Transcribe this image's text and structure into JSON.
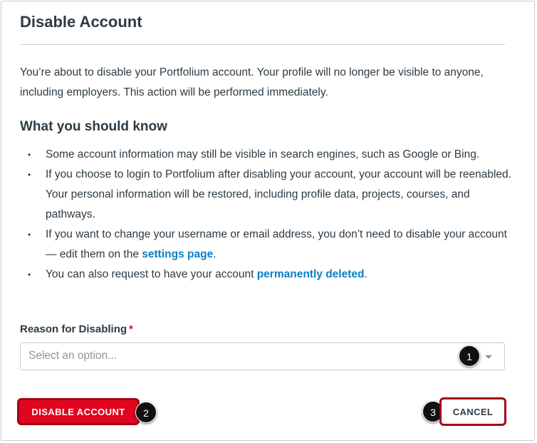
{
  "dialog": {
    "title": "Disable Account",
    "intro": "You’re about to disable your Portfolium account. Your profile will no longer be visible to anyone, including employers. This action will be performed immediately.",
    "subtitle": "What you should know",
    "bullets": {
      "b1": "Some account information may still be visible in search engines, such as Google or Bing.",
      "b2": "If you choose to login to Portfolium after disabling your account, your account will be reenabled. Your personal information will be restored, including profile data, projects, courses, and pathways.",
      "b3_before": "If you want to change your username or email address, you don’t need to disable your account — edit them on the ",
      "b3_link": "settings page",
      "b3_after": ".",
      "b4_before": "You can also request to have your account ",
      "b4_link": "permanently deleted",
      "b4_after": "."
    },
    "reason": {
      "label": "Reason for Disabling",
      "required_mark": "*",
      "placeholder": "Select an option..."
    },
    "buttons": {
      "disable": "DISABLE ACCOUNT",
      "cancel": "CANCEL"
    }
  },
  "callouts": {
    "c1": "1",
    "c2": "2",
    "c3": "3"
  },
  "colors": {
    "danger": "#e0061f",
    "link": "#0b7fc7",
    "text": "#2d3b45",
    "highlight_border": "#a3051a"
  }
}
